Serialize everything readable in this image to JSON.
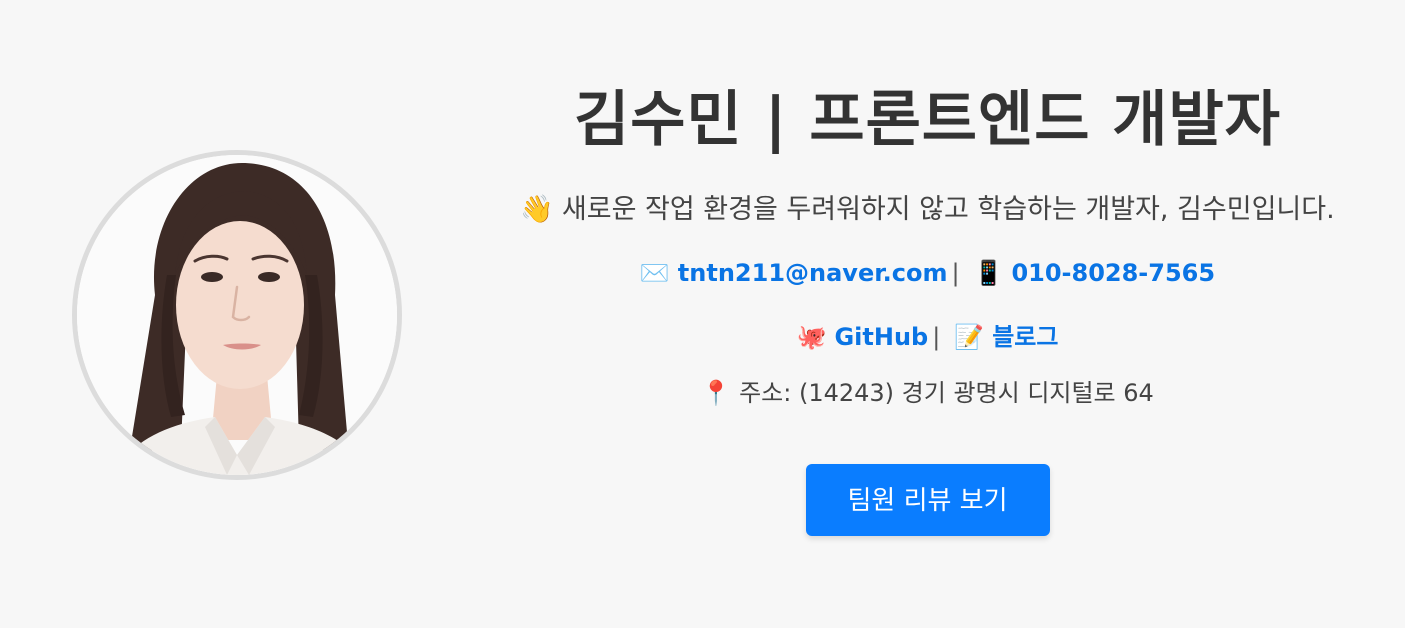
{
  "profile": {
    "title": "김수민 | 프론트엔드 개발자",
    "intro_emoji": "👋",
    "intro": "새로운 작업 환경을 두려워하지 않고 학습하는 개발자, 김수민입니다."
  },
  "contact": {
    "email_icon": "✉️",
    "email": "tntn211@naver.com",
    "separator": "|",
    "phone_icon": "📱",
    "phone": "010-8028-7565"
  },
  "links": {
    "github_icon": "🐙",
    "github_label": "GitHub",
    "separator": "|",
    "blog_icon": "📝",
    "blog_label": "블로그"
  },
  "address": {
    "icon": "📍",
    "text": "주소: (14243) 경기 광명시 디지털로 64"
  },
  "actions": {
    "review_button": "팀원 리뷰 보기"
  },
  "colors": {
    "link": "#0a74e4",
    "button": "#0a7dff",
    "background": "#f7f7f7"
  }
}
